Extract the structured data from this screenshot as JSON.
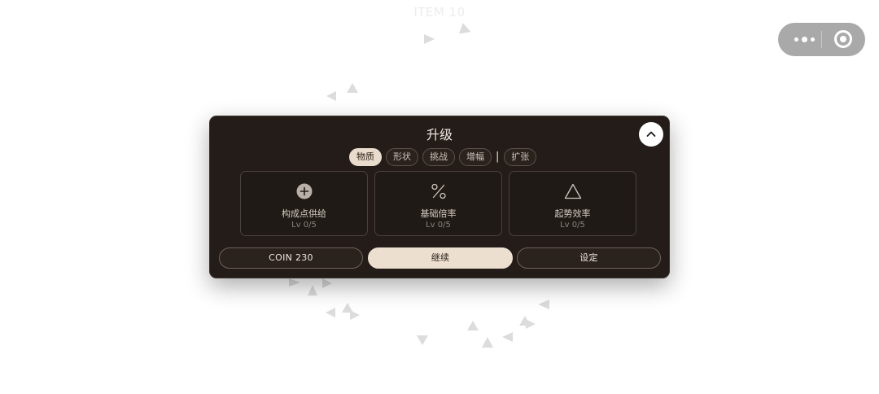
{
  "background": {
    "title": "ITEM 10",
    "decoration_color": "#dcdcdc"
  },
  "capsule": {
    "more_icon": "more-dots-icon",
    "close_icon": "target-close-icon",
    "color": "#a9a9a9"
  },
  "panel": {
    "title": "升级",
    "collapse_icon": "chevron-up-icon",
    "colors": {
      "panel": "#231c18",
      "accent": "#eadccd"
    },
    "tabs": [
      {
        "label": "物质",
        "active": true
      },
      {
        "label": "形状",
        "active": false
      },
      {
        "label": "挑战",
        "active": false
      },
      {
        "label": "增幅",
        "active": false
      },
      {
        "label": "扩张",
        "active": false
      }
    ],
    "tab_separator": "|",
    "cards": [
      {
        "icon": "plus-circle-icon",
        "name": "构成点供给",
        "level": "Lv 0/5"
      },
      {
        "icon": "percent-icon",
        "name": "基础倍率",
        "level": "Lv 0/5"
      },
      {
        "icon": "triangle-icon",
        "name": "起势效率",
        "level": "Lv 0/5"
      }
    ],
    "buttons": {
      "coin": "COIN 230",
      "continue": "继续",
      "settings": "设定"
    }
  }
}
